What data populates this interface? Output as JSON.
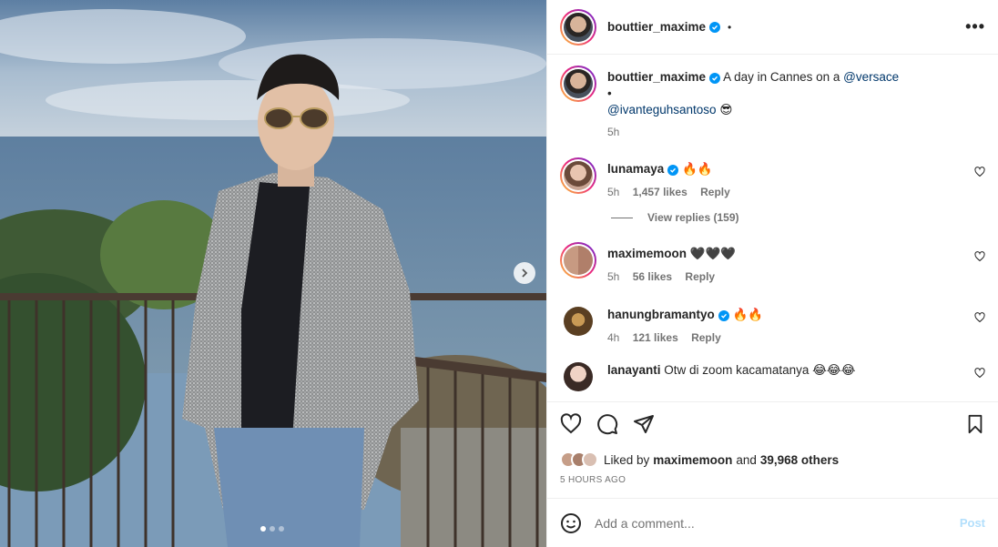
{
  "post": {
    "author": "bouttier_maxime",
    "header_dot": "•",
    "more_label": "•••",
    "caption_text": "A day in Cannes on a",
    "caption_mention1": "@versace",
    "caption_bullet": "•",
    "caption_mention2": "@ivanteguhsantoso",
    "caption_emoji": "😎",
    "caption_time": "5h",
    "carousel_count": 3,
    "carousel_active": 0
  },
  "comments": [
    {
      "user": "lunamaya",
      "verified": true,
      "text": "🔥🔥",
      "time": "5h",
      "likes": "1,457 likes",
      "reply": "Reply"
    },
    {
      "user": "maximemoon",
      "verified": false,
      "text": "🖤🖤🖤",
      "time": "5h",
      "likes": "56 likes",
      "reply": "Reply"
    },
    {
      "user": "hanungbramantyo",
      "verified": true,
      "text": "🔥🔥",
      "time": "4h",
      "likes": "121 likes",
      "reply": "Reply"
    },
    {
      "user": "lanayanti",
      "verified": false,
      "text": "Otw di zoom kacamatanya 😂😂😂"
    }
  ],
  "view_replies": "View replies (159)",
  "likes": {
    "prefix": "Liked by",
    "user": "maximemoon",
    "middle": "and",
    "others": "39,968 others"
  },
  "time_ago": "5 HOURS AGO",
  "add_comment": {
    "placeholder": "Add a comment...",
    "post_label": "Post"
  },
  "icons": {
    "like": "heart-icon",
    "comment": "comment-icon",
    "share": "send-icon",
    "save": "bookmark-icon",
    "emoji": "emoji-icon",
    "more": "more-icon",
    "next": "chevron-right-icon"
  },
  "colors": {
    "verified": "#0095f6",
    "link": "#00376b",
    "muted": "#737373",
    "post_disabled": "#b2dffc"
  }
}
